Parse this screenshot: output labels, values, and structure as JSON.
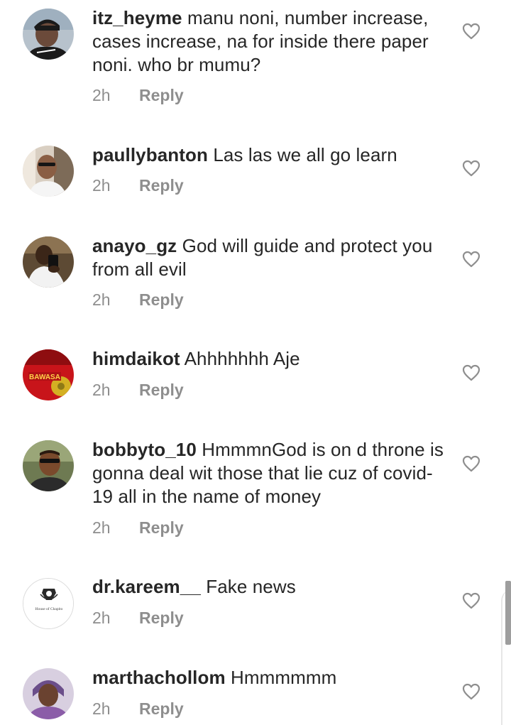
{
  "comments": [
    {
      "username": "itz_heyme",
      "text": "manu noni, number increase, cases increase, na for inside there paper noni. who br mumu?",
      "time": "2h",
      "reply_label": "Reply",
      "avatar": "man-in-black-cap"
    },
    {
      "username": "paullybanton",
      "text": "Las las we all go learn",
      "time": "2h",
      "reply_label": "Reply",
      "avatar": "man-in-white-shirt"
    },
    {
      "username": "anayo_gz",
      "text": "God will guide and protect you from all evil",
      "time": "2h",
      "reply_label": "Reply",
      "avatar": "man-taking-selfie"
    },
    {
      "username": "himdaikot",
      "text": "Ahhhhhhh Aje",
      "time": "2h",
      "reply_label": "Reply",
      "avatar": "bawasa-album-cover",
      "avatar_text": "BAWASA"
    },
    {
      "username": "bobbyto_10",
      "text": "HmmmnGod is on d throne is gonna deal wit those that lie cuz of covid-19 all in the  name of money",
      "time": "2h",
      "reply_label": "Reply",
      "avatar": "man-in-sunglasses"
    },
    {
      "username": "dr.kareem__",
      "text": "Fake news",
      "time": "2h",
      "reply_label": "Reply",
      "avatar": "logo-crest",
      "avatar_text": "House of Chapito"
    },
    {
      "username": "marthachollom",
      "text": "Hmmmmmm",
      "time": "2h",
      "reply_label": "Reply",
      "avatar": "woman-portrait"
    }
  ],
  "colors": {
    "text": "#262626",
    "meta": "#8e8e8e",
    "icon": "#8e8e8e"
  },
  "icons": {
    "like": "heart-outline-icon"
  }
}
